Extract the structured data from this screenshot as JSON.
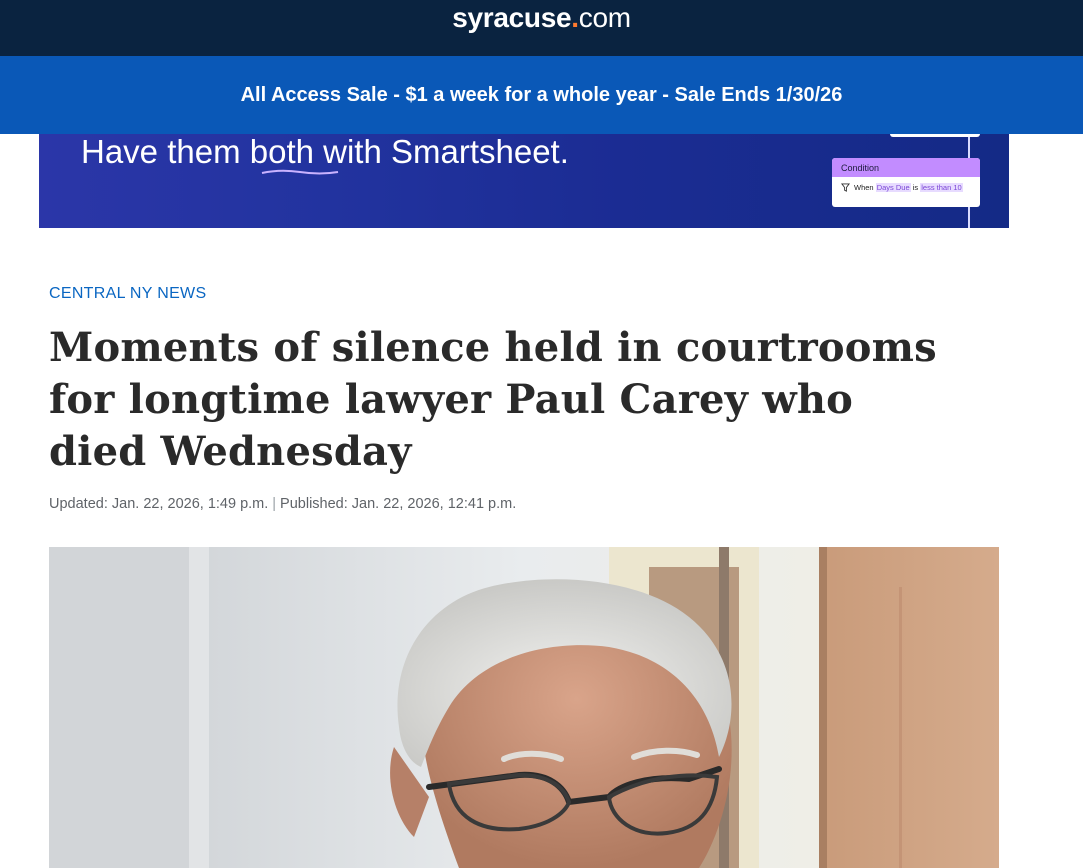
{
  "header": {
    "logo_brand": "syracuse",
    "logo_dot": ".",
    "logo_tld": "com"
  },
  "promo_banner": {
    "text": "All Access Sale - $1 a week for a whole year - Sale Ends 1/30/26"
  },
  "advertisement": {
    "headline": "Have them both with Smartsheet.",
    "condition_card": {
      "title": "Condition",
      "prefix": "When",
      "field": "Days Due",
      "operator_word": "is",
      "value": "less than 10"
    }
  },
  "article": {
    "section": "CENTRAL NY NEWS",
    "title": "Moments of silence held in courtrooms for longtime lawyer Paul Carey who died Wednesday",
    "updated": "Updated: Jan. 22, 2026, 1:49 p.m.",
    "separator": "|",
    "published": "Published: Jan. 22, 2026, 12:41 p.m."
  },
  "colors": {
    "header_bg": "#0a2340",
    "promo_bg": "#0a58b7",
    "kicker": "#0a66c2",
    "logo_dot": "#ff7a2f",
    "ad_accent": "#c28cff"
  }
}
